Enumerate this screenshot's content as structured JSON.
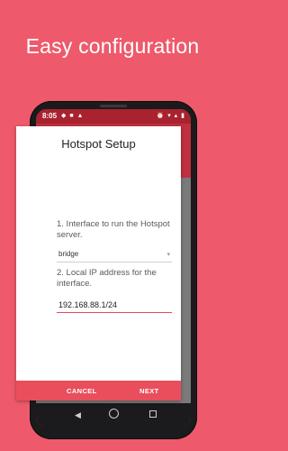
{
  "headline": "Easy configuration",
  "status_bar": {
    "time": "8:05",
    "left_icons": "◆ ■ ▲",
    "right_icons": "⏰ ▾ ▴ ▮"
  },
  "dialog": {
    "title": "Hotspot Setup",
    "interface_label": "1. Interface to run the Hotspot server.",
    "interface_selected": "bridge",
    "ip_label": "2. Local IP address for the interface.",
    "ip_value": "192.168.88.1/24",
    "cancel_label": "CANCEL",
    "next_label": "NEXT"
  },
  "navigation": {
    "back_icon": "back-icon",
    "home_icon": "home-icon",
    "recent_icon": "recent-apps-icon"
  },
  "colors": {
    "background": "#ee5a6b",
    "accent": "#e94e5c",
    "status_bar": "#a8222f"
  }
}
